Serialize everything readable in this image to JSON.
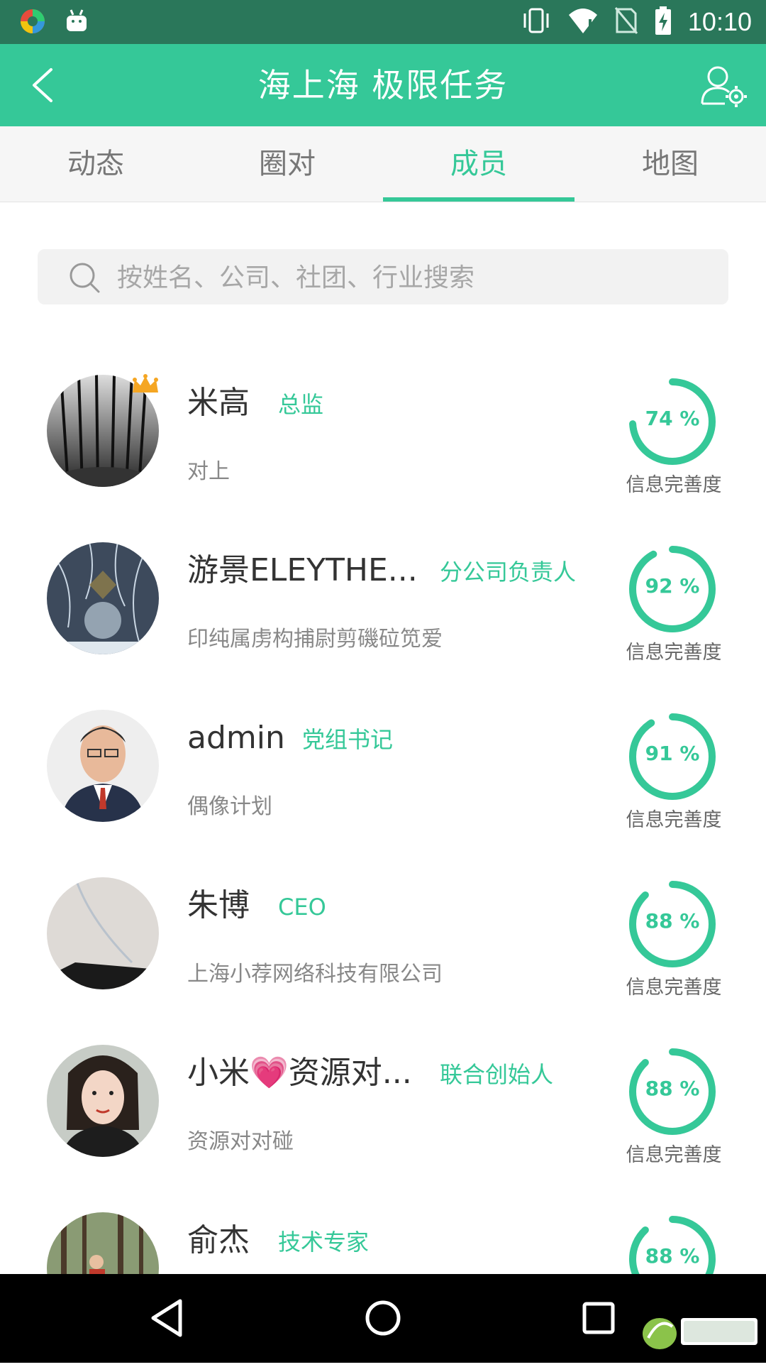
{
  "status_bar": {
    "time": "10:10",
    "icons": [
      "app-icon",
      "android-icon",
      "vibrate-icon",
      "wifi-icon",
      "no-sim-icon",
      "battery-charging-icon"
    ]
  },
  "header": {
    "title": "海上海 极限任务",
    "back_icon": "chevron-left-icon",
    "settings_icon": "user-settings-icon"
  },
  "tabs": [
    {
      "label": "动态",
      "active": false
    },
    {
      "label": "圈对",
      "active": false
    },
    {
      "label": "成员",
      "active": true
    },
    {
      "label": "地图",
      "active": false
    }
  ],
  "search": {
    "placeholder": "按姓名、公司、社团、行业搜索"
  },
  "ring_caption": "信息完善度",
  "members": [
    {
      "name": "米高",
      "role": "总监",
      "company": "对上",
      "completion": "74 %",
      "completion_value": 74,
      "crown": true
    },
    {
      "name": "游景ELEYTHE...",
      "role": "分公司负责人",
      "company": "印纯属虏构捕尉剪磯砬笕爱",
      "completion": "92 %",
      "completion_value": 92,
      "crown": false
    },
    {
      "name": "admin",
      "role": "党组书记",
      "company": "偶像计划",
      "completion": "91 %",
      "completion_value": 91,
      "crown": false
    },
    {
      "name": "朱博",
      "role": "CEO",
      "company": "上海小荐网络科技有限公司",
      "completion": "88 %",
      "completion_value": 88,
      "crown": false
    },
    {
      "name": "小米💗资源对...",
      "role": "联合创始人",
      "company": "资源对对碰",
      "completion": "88 %",
      "completion_value": 88,
      "crown": false
    },
    {
      "name": "俞杰",
      "role": "技术专家",
      "company": "",
      "completion": "88 %",
      "completion_value": 88,
      "crown": false
    }
  ],
  "nav_bar": {
    "icons": [
      "back-triangle-icon",
      "home-circle-icon",
      "recents-square-icon"
    ]
  },
  "colors": {
    "accent": "#35c898",
    "status_bar": "#2a775a",
    "ring_track": "#ffffff",
    "tab_text": "#777777"
  }
}
